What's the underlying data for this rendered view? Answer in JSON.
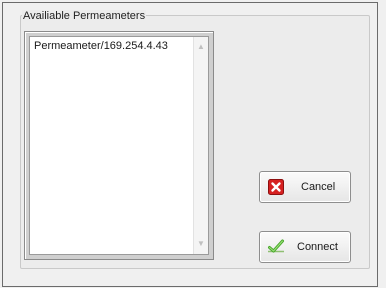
{
  "window": {
    "group_label": "Availiable Permeameters",
    "list": {
      "items": [
        "Permeameter/169.254.4.43"
      ],
      "scroll_up_glyph": "▲",
      "scroll_down_glyph": "▼"
    },
    "buttons": {
      "cancel": {
        "label": "Cancel",
        "icon": "red-x-icon",
        "icon_color": "#d62020"
      },
      "connect": {
        "label": "Connect",
        "icon": "green-check-icon",
        "icon_color": "#4aa82c"
      }
    }
  }
}
